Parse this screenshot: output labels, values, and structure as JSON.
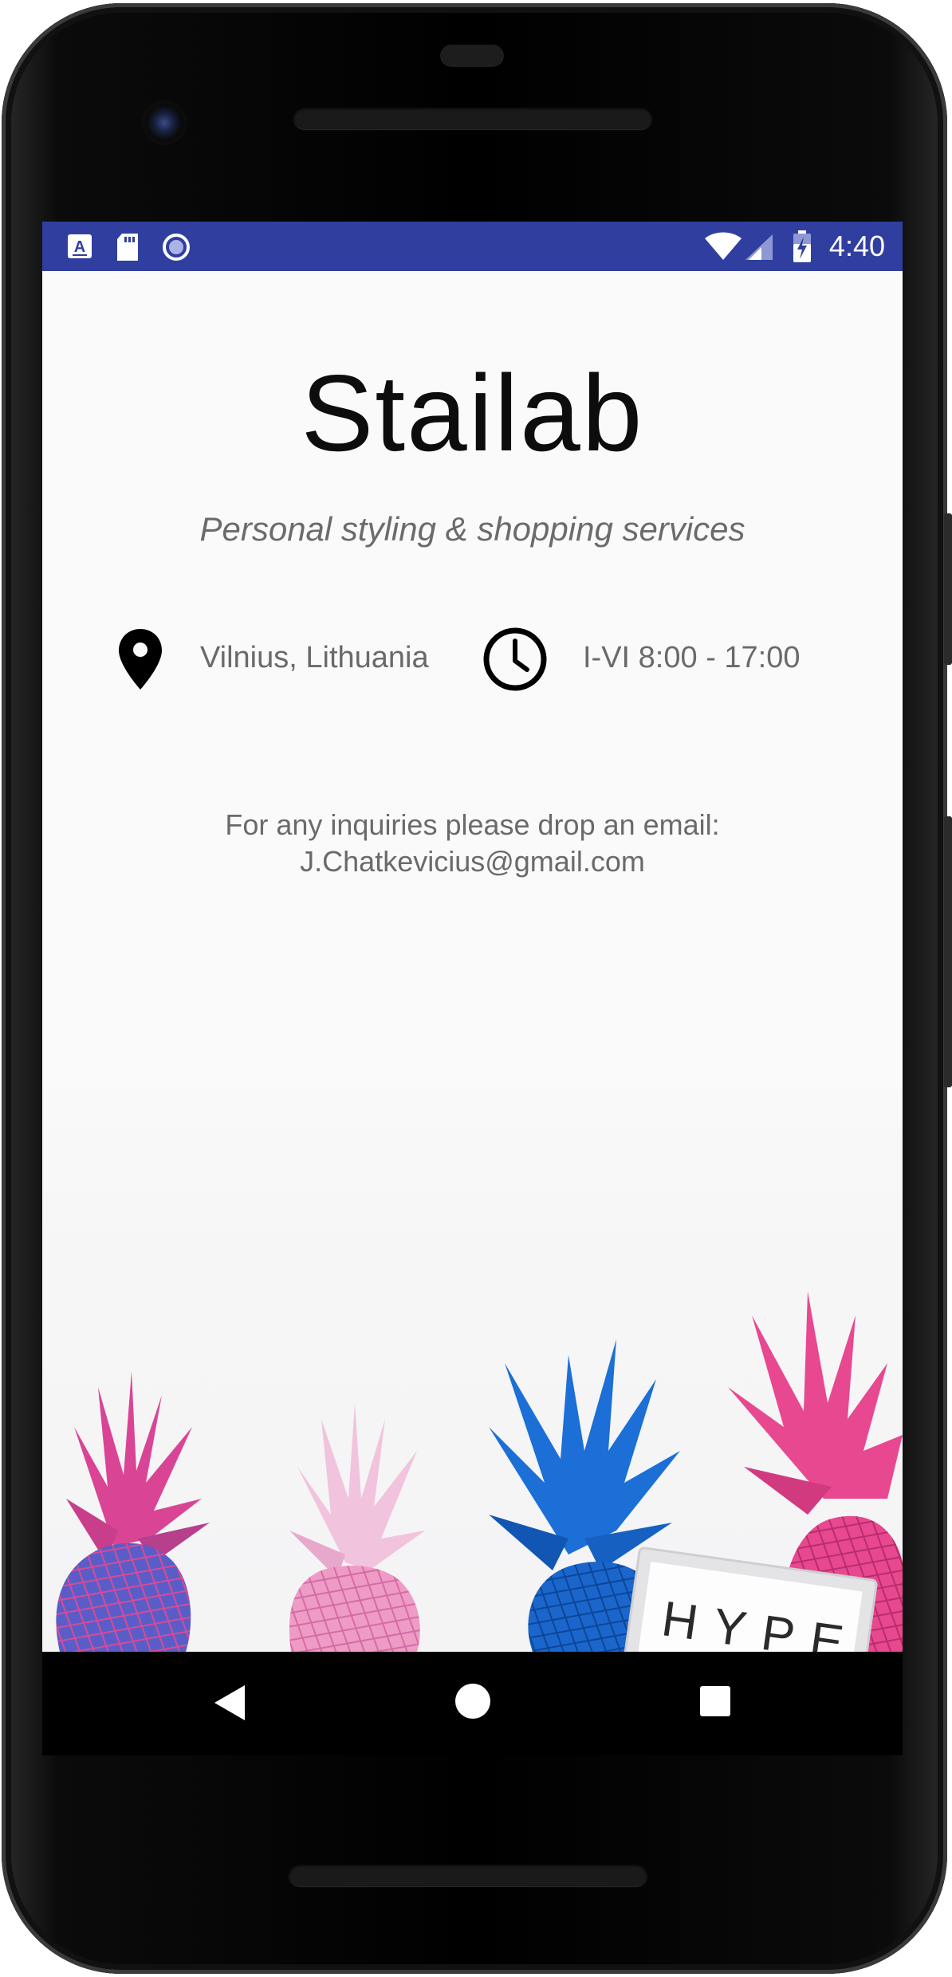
{
  "status_bar": {
    "time": "4:40",
    "left_icons": [
      "keyboard-a-icon",
      "sd-card-icon",
      "circle-notification-icon"
    ],
    "right_icons": [
      "wifi-icon",
      "signal-icon",
      "battery-charging-icon"
    ],
    "color": "#303f9f"
  },
  "app": {
    "title": "Stailab",
    "subtitle": "Personal styling & shopping services",
    "location": {
      "icon": "location-pin-icon",
      "text": "Vilnius, Lithuania"
    },
    "hours": {
      "icon": "clock-icon",
      "text": "I-VI 8:00 - 17:00"
    },
    "contact_line": "For any inquiries please drop an email:",
    "email": "J.Chatkevicius@gmail.com",
    "hero_image": {
      "lightbox_text": "HYPE",
      "colors": {
        "pink": "#e8478f",
        "blue": "#1a6ad4",
        "pale_pink": "#f0a9cf"
      }
    }
  },
  "nav_bar": {
    "buttons": [
      "back-icon",
      "home-icon",
      "recents-icon"
    ]
  }
}
